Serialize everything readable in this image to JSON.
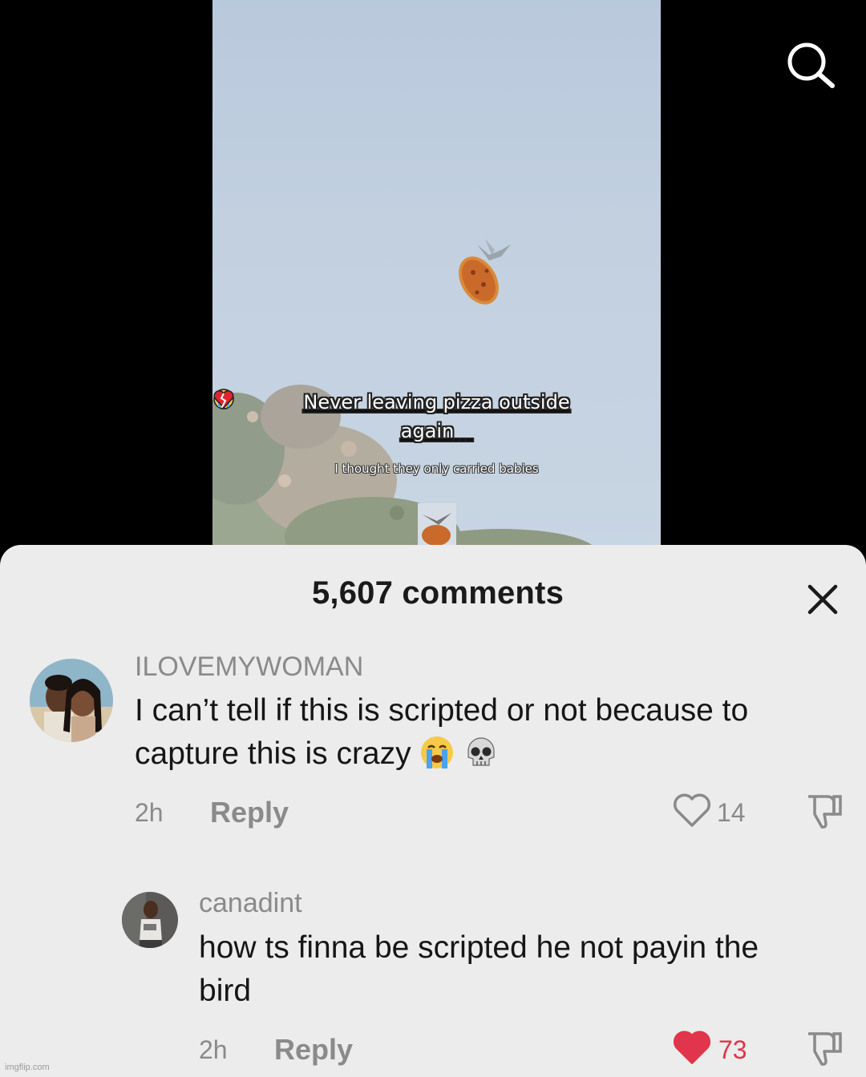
{
  "video": {
    "caption_line1": "Never leaving pizza outside",
    "caption_line2": "again",
    "sub_caption": "I thought they only carried babies"
  },
  "sheet": {
    "title": "5,607 comments"
  },
  "comments": [
    {
      "username": "ILOVEMYWOMAN",
      "text_line1": "I can’t tell if this is scripted or not because to",
      "text_line2": "capture this is crazy",
      "emojis": [
        "loudly-crying-face",
        "skull"
      ],
      "time": "2h",
      "reply_label": "Reply",
      "likes": "14",
      "liked": false
    },
    {
      "username": "canadint",
      "text_line1": "how ts finna be scripted he not payin the",
      "text_line2": "bird",
      "time": "2h",
      "reply_label": "Reply",
      "likes": "73",
      "liked": true
    }
  ],
  "icons": {
    "search": "search-icon",
    "close": "close-icon",
    "like": "heart-icon",
    "dislike": "thumbs-down-icon"
  },
  "colors": {
    "liked": "#e0354a",
    "sheet_bg": "#ececec",
    "muted_text": "#8a8a8a"
  },
  "watermark": "imgflip.com"
}
